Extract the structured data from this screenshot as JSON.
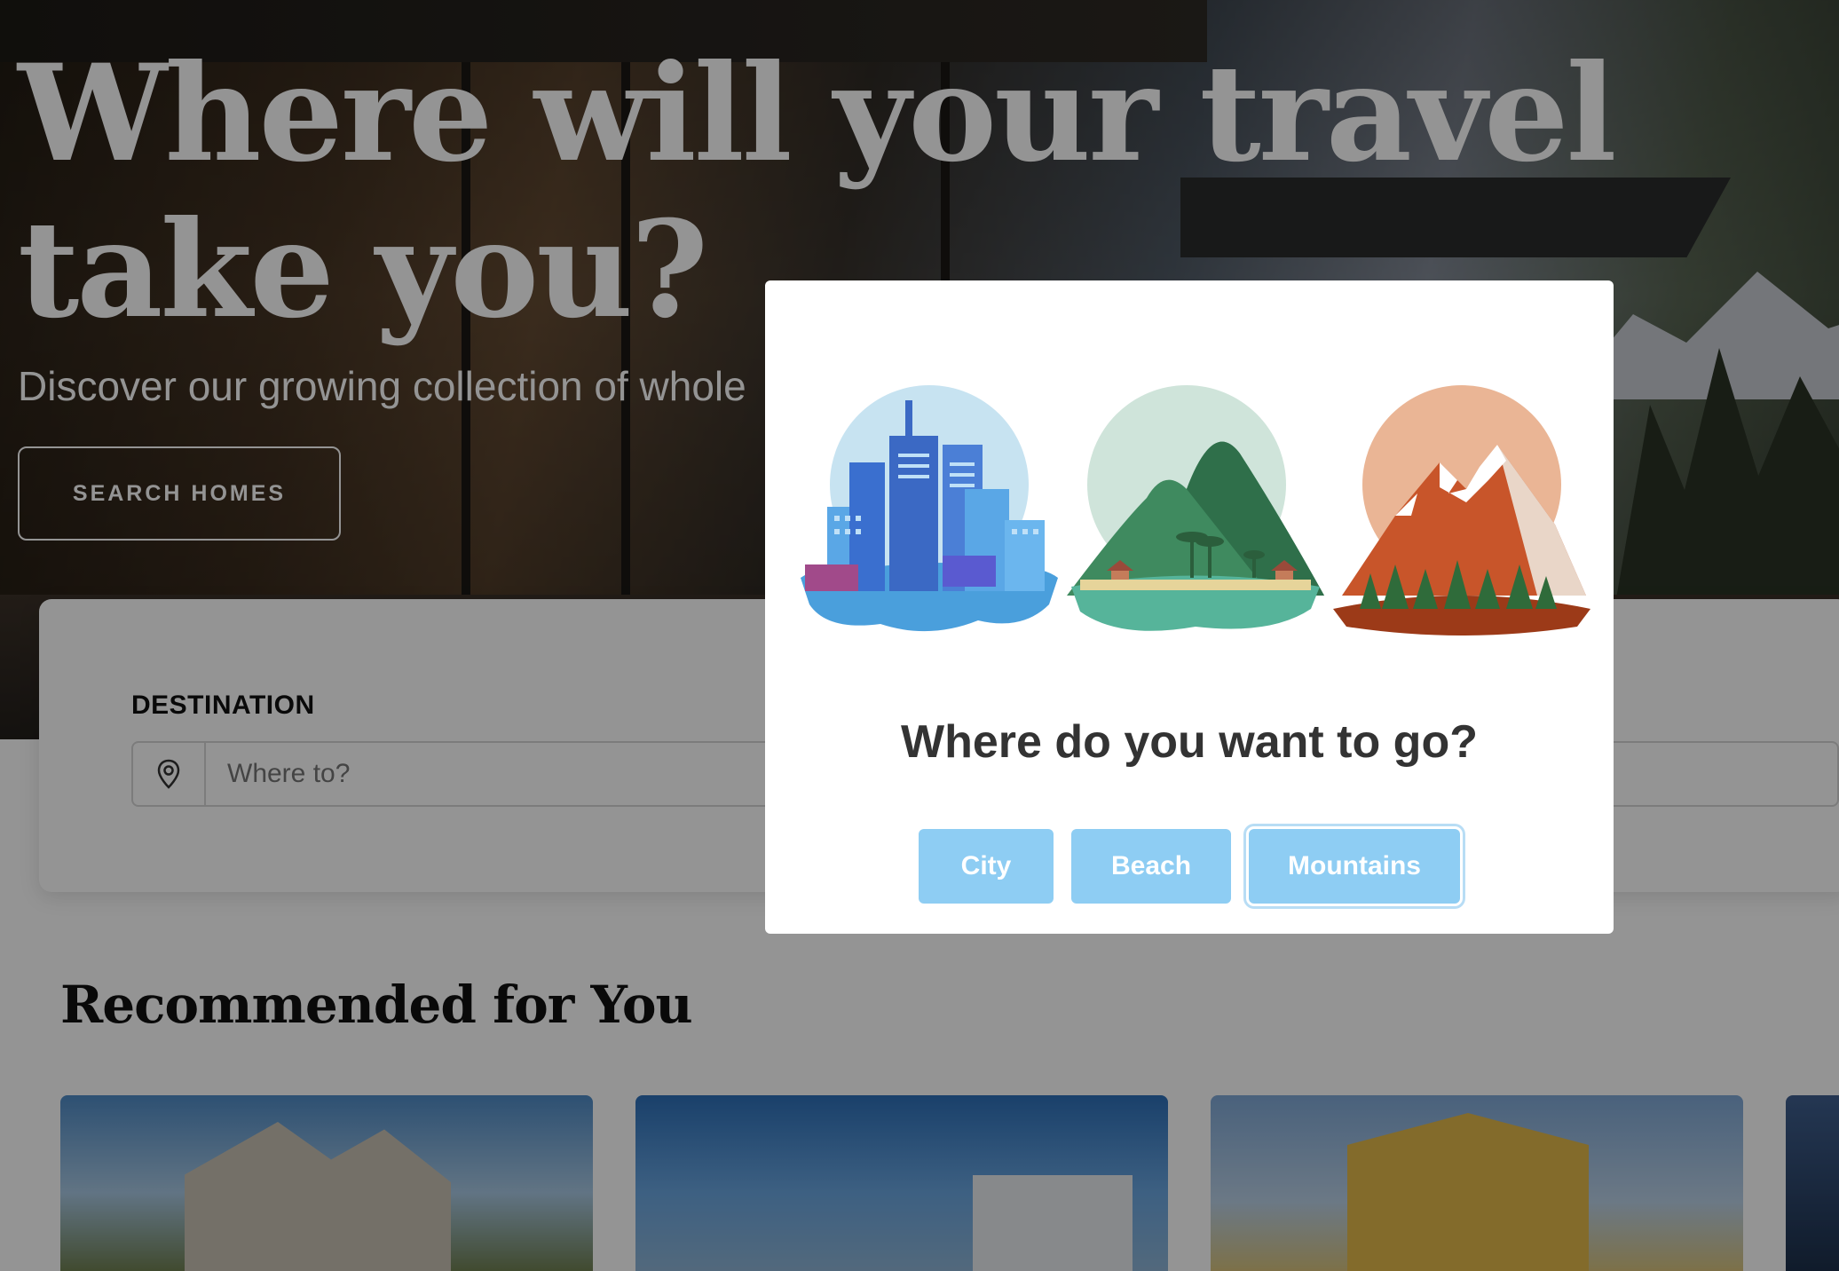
{
  "hero": {
    "title": "Where will your travel take you?",
    "subtitle": "Discover our growing collection of whole",
    "search_button_label": "SEARCH HOMES"
  },
  "search": {
    "destination_label": "DESTINATION",
    "destination_placeholder": "Where to?"
  },
  "recommendations": {
    "title": "Recommended for You"
  },
  "modal": {
    "illustrations": [
      "city-illustration",
      "beach-illustration",
      "mountains-illustration"
    ],
    "question": "Where do you want to go?",
    "options": [
      {
        "label": "City",
        "selected": false
      },
      {
        "label": "Beach",
        "selected": false
      },
      {
        "label": "Mountains",
        "selected": true
      }
    ]
  },
  "colors": {
    "choice_button": "#8ecdf3",
    "overlay": "rgba(0,0,0,0.42)",
    "question_text": "#333333"
  }
}
